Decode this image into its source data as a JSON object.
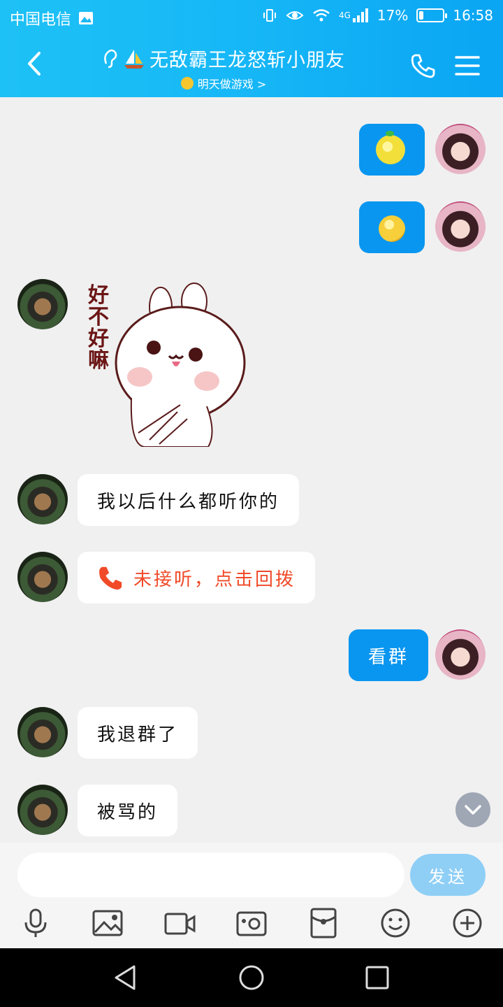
{
  "status_bar": {
    "carrier": "中国电信",
    "network": "4G",
    "battery": "17%",
    "battery_level": 0.17,
    "time": "16:58"
  },
  "header": {
    "title": "无敌霸王龙怒斩小朋友",
    "subtitle": "明天做游戏 >"
  },
  "messages": [
    {
      "side": "right",
      "kind": "emoji",
      "emoji": "lemon-emoji"
    },
    {
      "side": "right",
      "kind": "emoji",
      "emoji": "yellow-coin-emoji"
    },
    {
      "side": "left",
      "kind": "sticker",
      "text": "好不好嘛"
    },
    {
      "side": "left",
      "kind": "text",
      "text": "我以后什么都听你的"
    },
    {
      "side": "left",
      "kind": "missed-call",
      "text": "未接听，点击回拨"
    },
    {
      "side": "right",
      "kind": "text",
      "text": "看群"
    },
    {
      "side": "left",
      "kind": "text",
      "text": "我退群了"
    },
    {
      "side": "left",
      "kind": "text",
      "text": "被骂的"
    }
  ],
  "input": {
    "value": "",
    "send_label": "发送"
  },
  "toolbar": [
    "microphone-icon",
    "image-icon",
    "video-icon",
    "camera-icon",
    "red-packet-icon",
    "emoji-icon",
    "plus-icon"
  ],
  "colors": {
    "header_blue": "#17b8f7",
    "bubble_blue": "#0996f0",
    "missed_call_red": "#f04a28",
    "send_button": "#8fcff6"
  }
}
